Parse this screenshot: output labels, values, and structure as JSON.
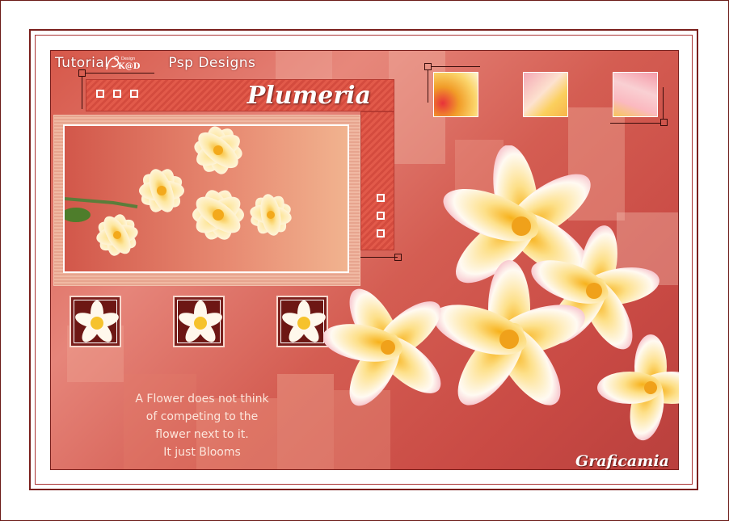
{
  "header": {
    "tutorial_label": "Tutorial",
    "brand_label": "Psp Designs",
    "logo_text": "K@D",
    "logo_small": "Design"
  },
  "banner": {
    "title": "Plumeria"
  },
  "quote": {
    "lines": [
      "A Flower does not think",
      "of competing to the",
      "flower next to it.",
      "It just Blooms"
    ]
  },
  "signature": "Graficamia",
  "colors": {
    "frame": "#7a1f1c",
    "accent": "#d8574a",
    "petal": "#fffaf3",
    "center": "#f6c22c"
  }
}
